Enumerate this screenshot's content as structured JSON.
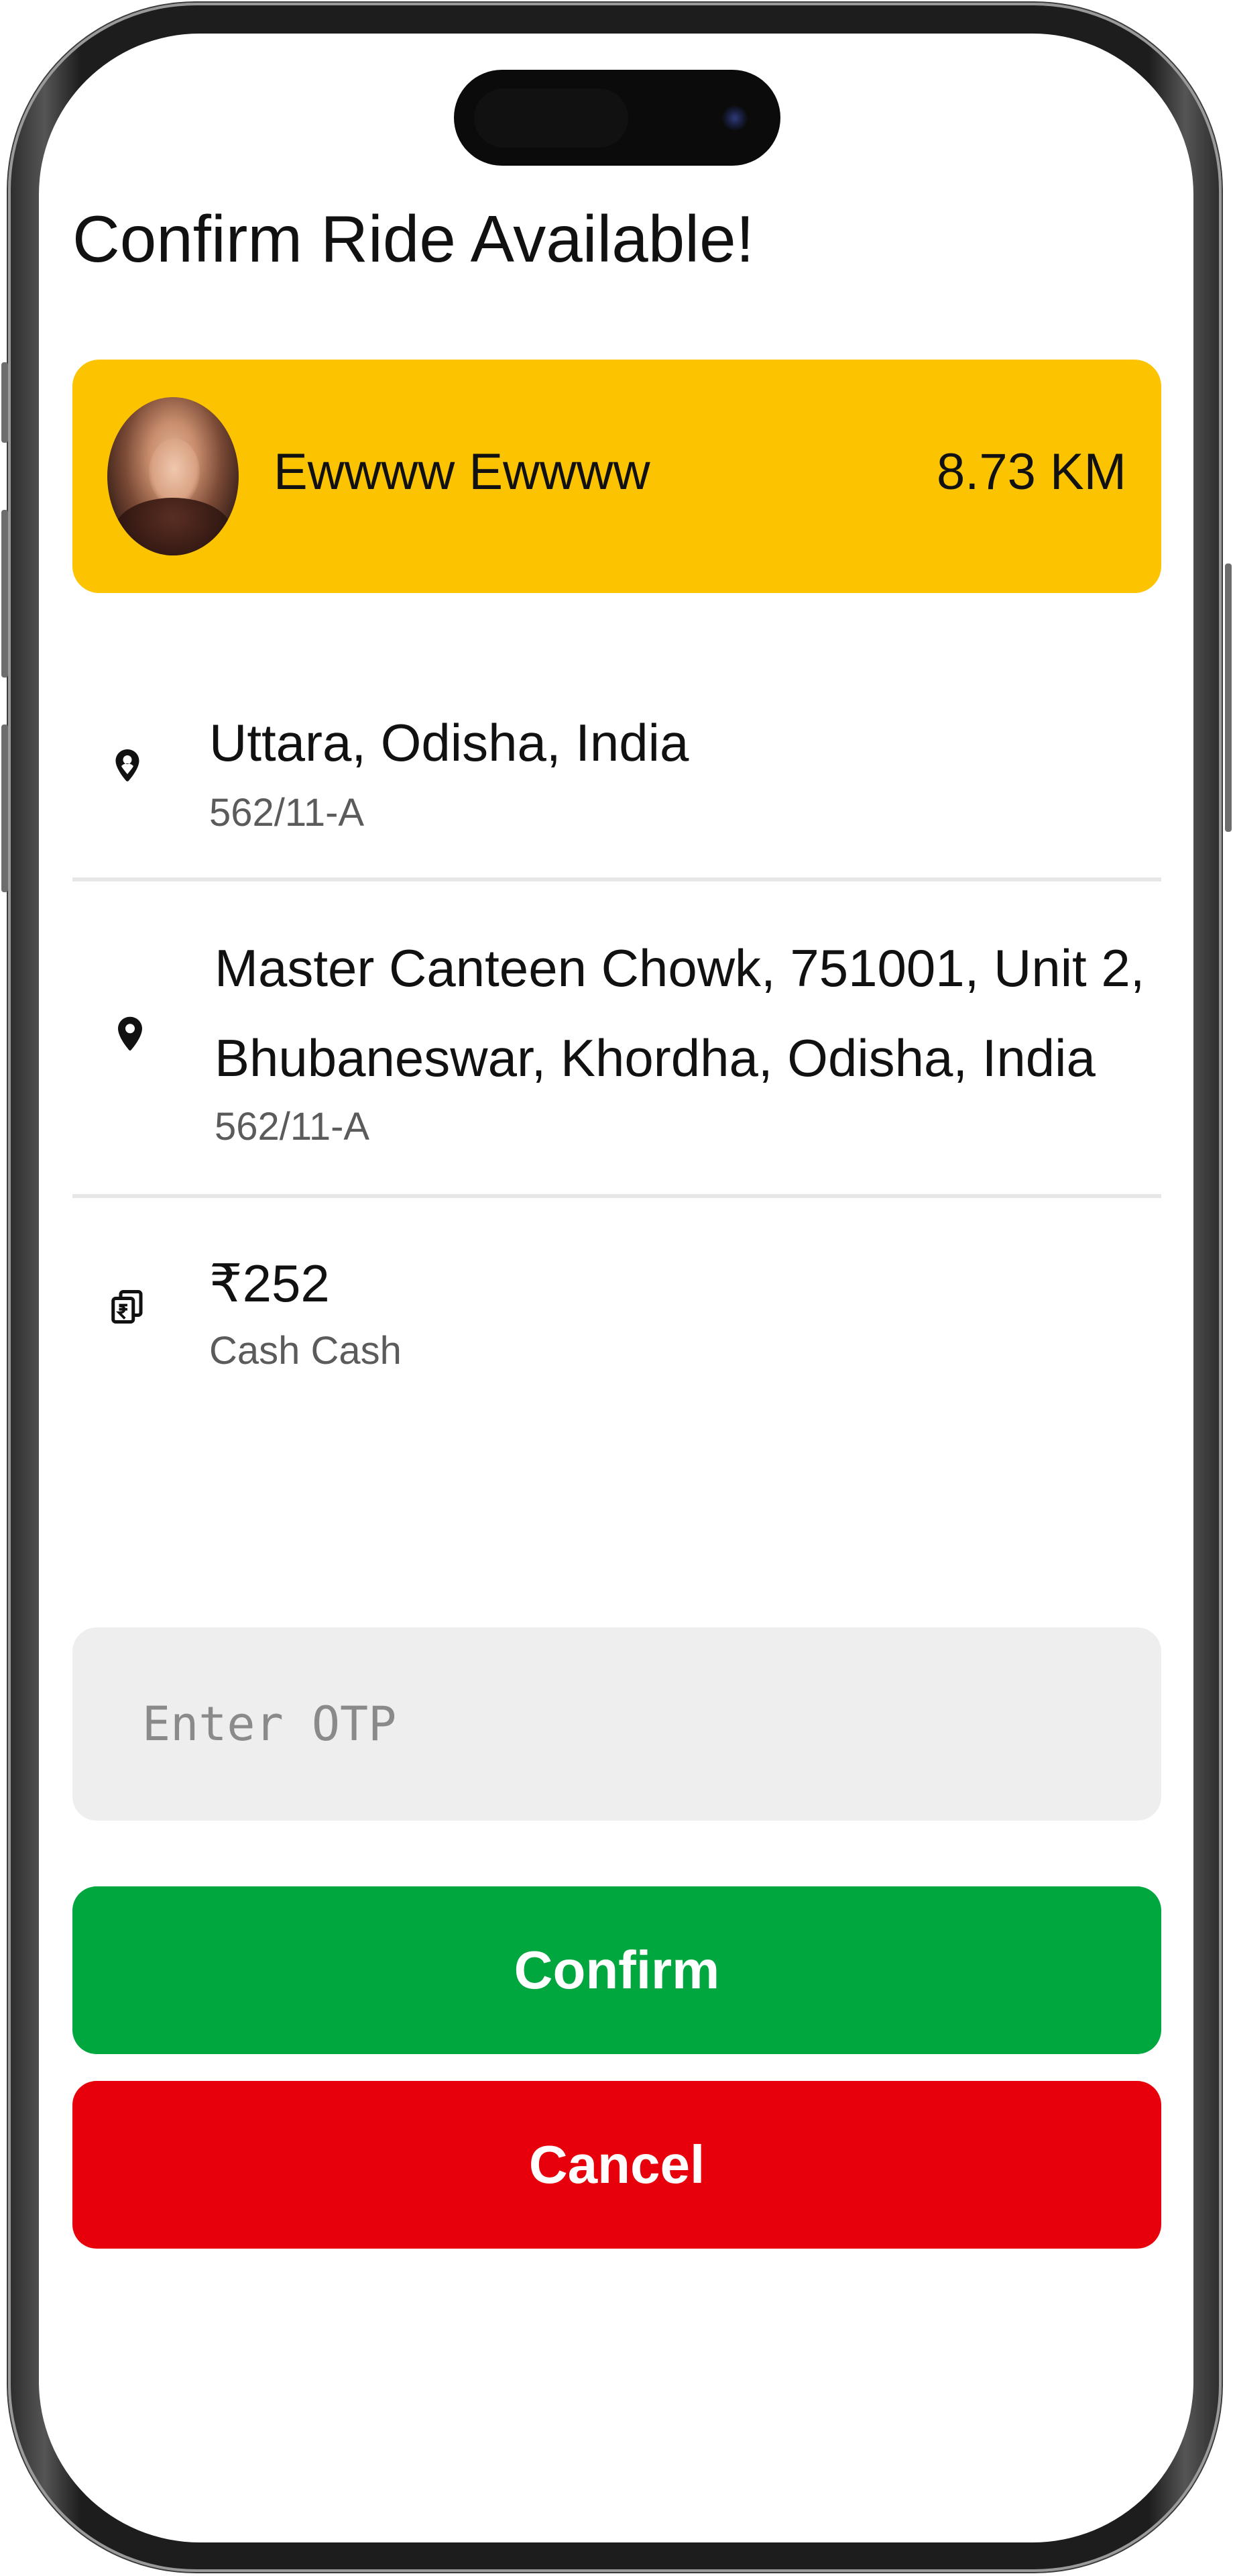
{
  "page": {
    "title": "Confirm Ride Available!"
  },
  "driver": {
    "name": "Ewwww Ewwww",
    "distance": "8.73 KM",
    "avatar_icon": "user-photo"
  },
  "pickup": {
    "icon": "pickup-location-icon",
    "address": "Uttara, Odisha, India",
    "sub": "562/11-A"
  },
  "destination": {
    "icon": "map-pin-icon",
    "address_line1": "Master Canteen Chowk, 751001, Unit 2,",
    "address_line2": "Bhubaneswar, Khordha, Odisha, India",
    "sub": "562/11-A"
  },
  "fare": {
    "icon": "payment-icon",
    "amount": "₹252",
    "method": "Cash Cash"
  },
  "otp": {
    "placeholder": "Enter OTP",
    "value": ""
  },
  "actions": {
    "confirm_label": "Confirm",
    "cancel_label": "Cancel"
  },
  "colors": {
    "driver_card": "#fcc400",
    "confirm": "#00a63e",
    "cancel": "#e7000b",
    "otp_bg": "#eeeeee"
  }
}
